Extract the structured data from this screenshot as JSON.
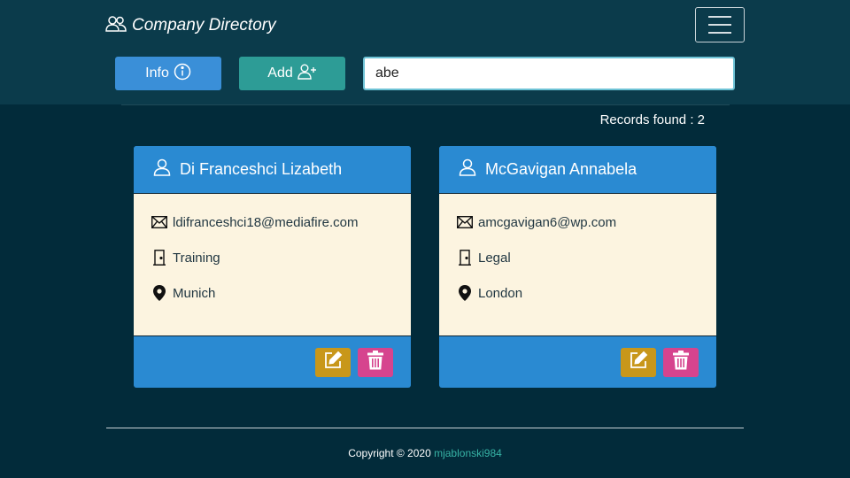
{
  "header": {
    "title": "Company Directory",
    "menu_icon": "hamburger-icon"
  },
  "toolbar": {
    "info_label": "Info",
    "info_icon": "info-circle-icon",
    "add_label": "Add",
    "add_icon": "add-user-icon",
    "search_value": "abe"
  },
  "results": {
    "records_text": "Records found : 2"
  },
  "cards": [
    {
      "name": "Di Franceshci Lizabeth",
      "email": "ldifranceshci18@mediafire.com",
      "department": "Training",
      "location": "Munich"
    },
    {
      "name": "McGavigan Annabela",
      "email": "amcgavigan6@wp.com",
      "department": "Legal",
      "location": "London"
    }
  ],
  "footer": {
    "copyright": "Copyright © 2020",
    "author": "mjablonski984"
  },
  "colors": {
    "background": "#022b3a",
    "topbar": "#0b3b4b",
    "info_button": "#3a8fd8",
    "add_button": "#2d9c96",
    "card_header": "#2a8ad2",
    "card_body": "#fcf4e0",
    "edit_button": "#c8971a",
    "delete_button": "#d6448e",
    "footer_link": "#37b3a5"
  }
}
